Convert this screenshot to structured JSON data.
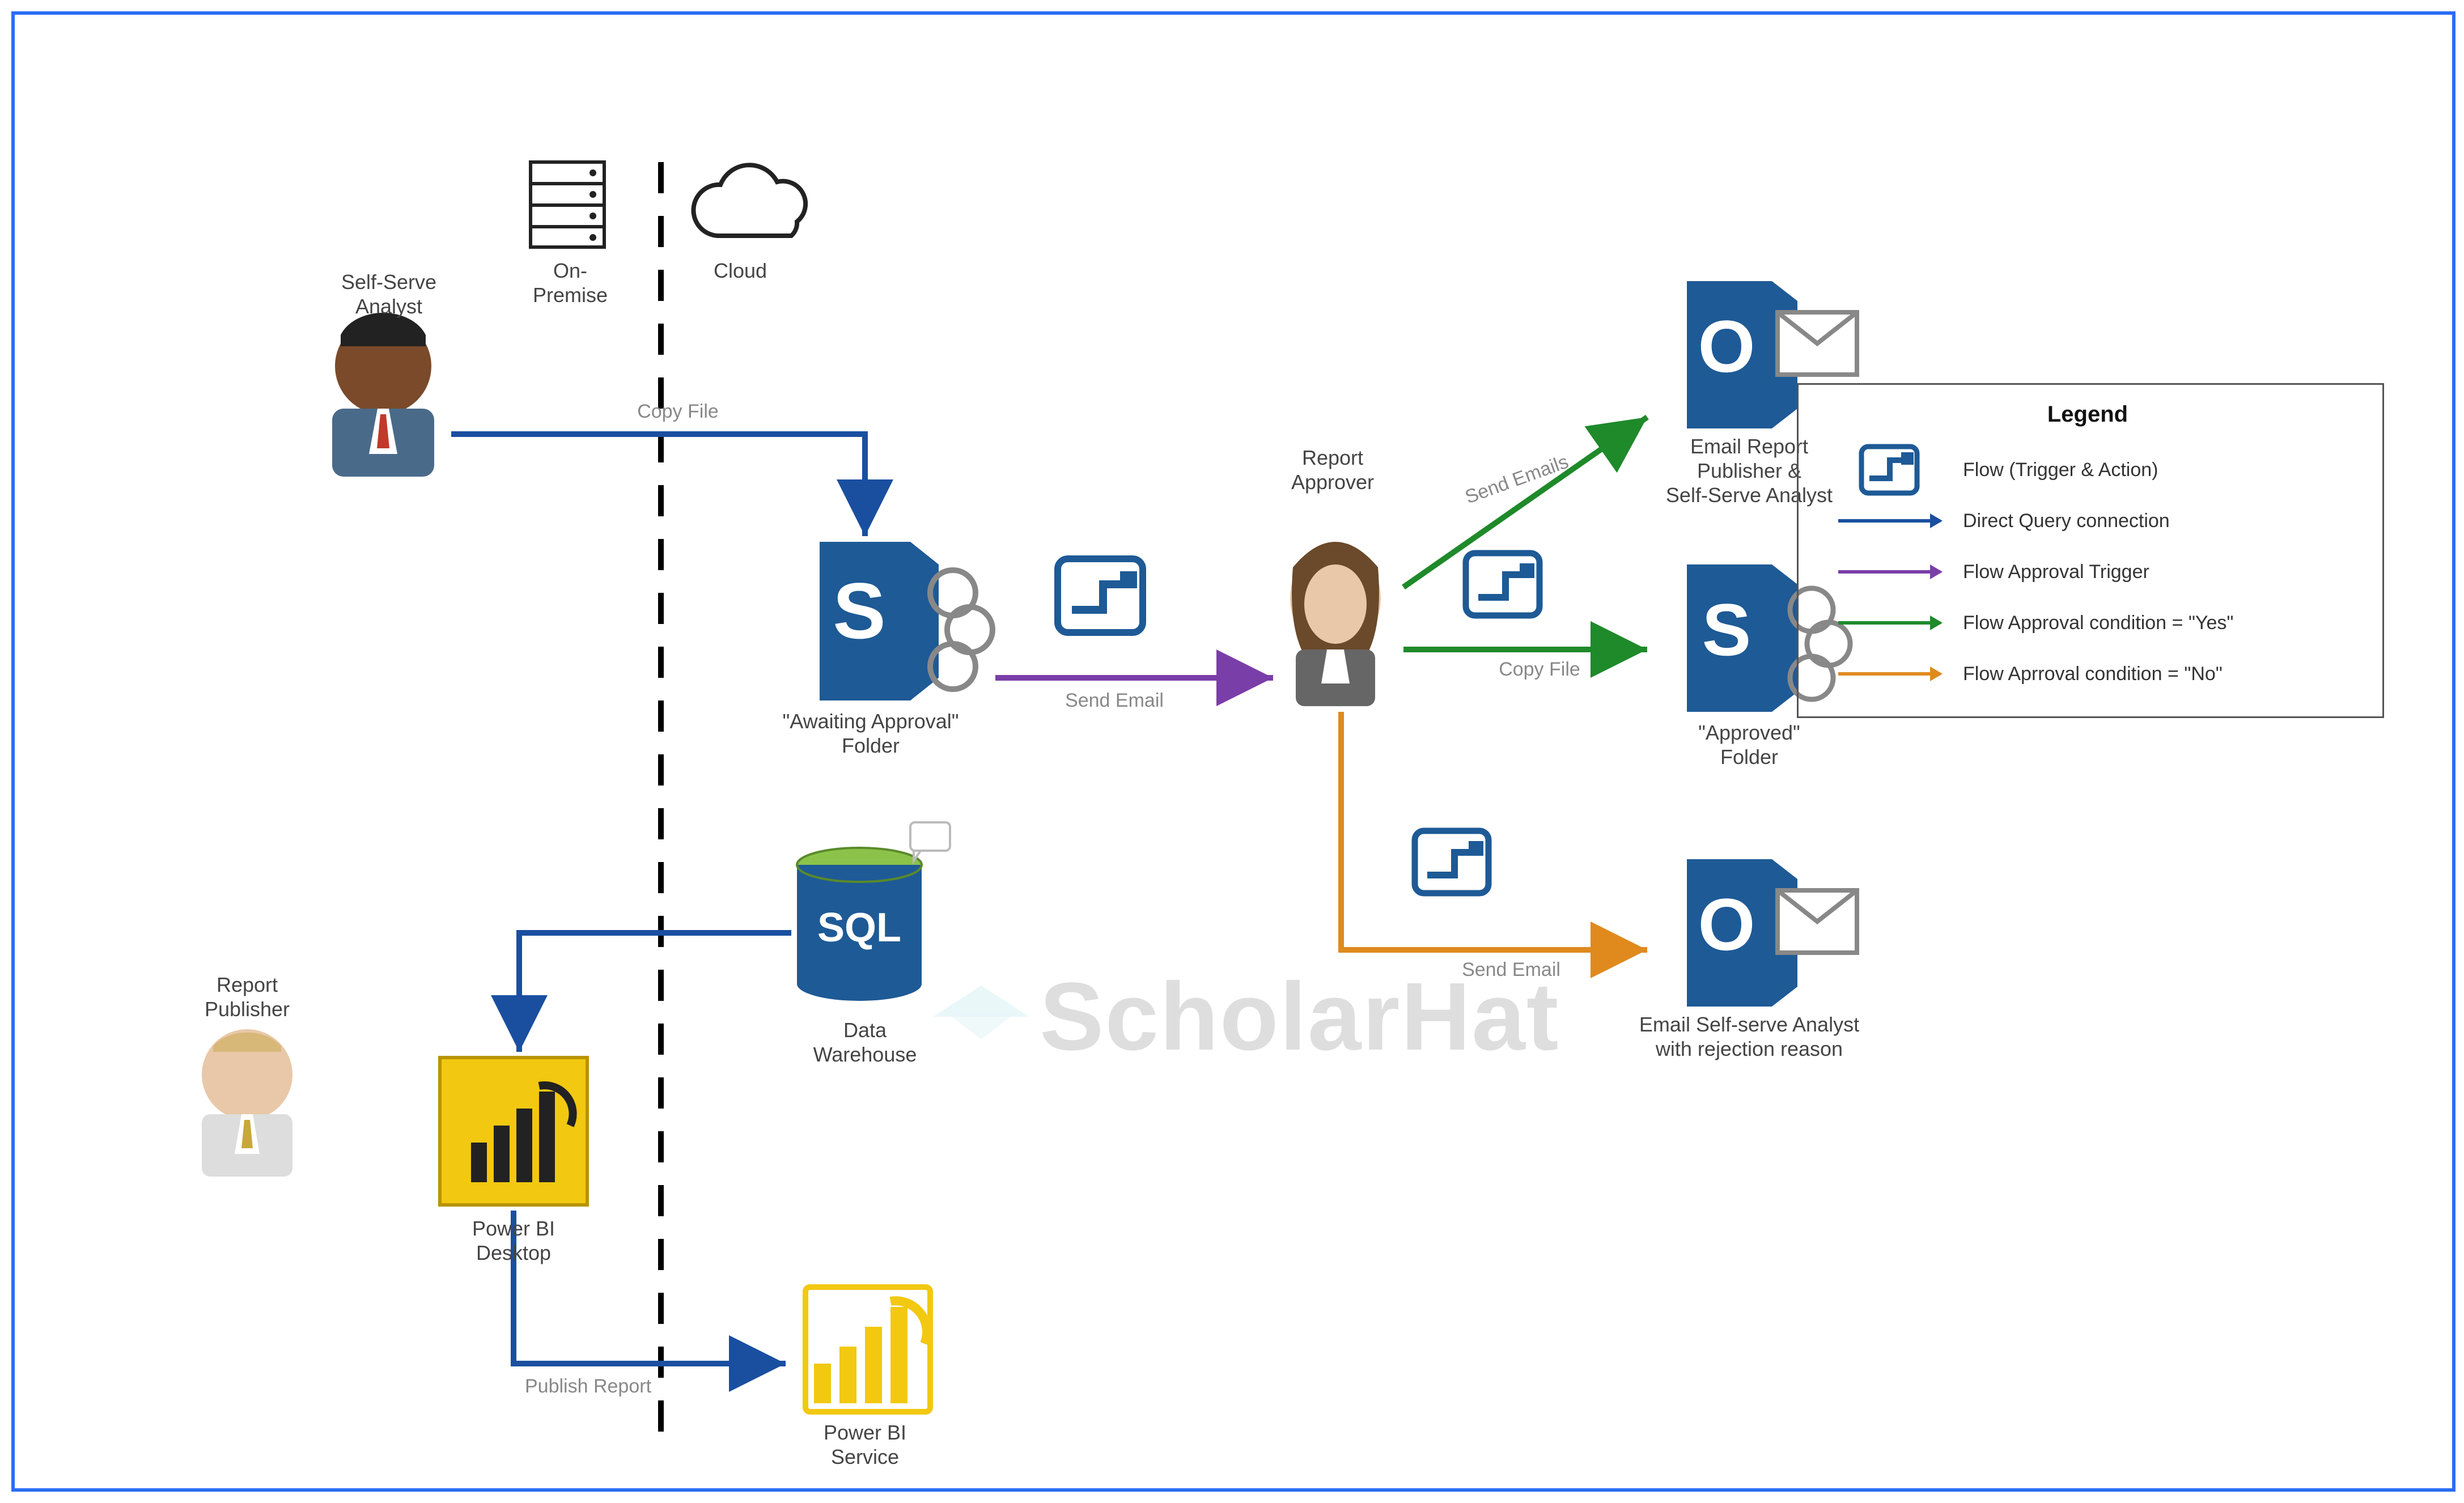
{
  "nodes": {
    "self_serve_analyst": "Self-Serve\nAnalyst",
    "on_premise": "On-Premise",
    "cloud": "Cloud",
    "awaiting_folder": "\"Awaiting Approval\"\nFolder",
    "report_approver": "Report\nApprover",
    "email_publisher_analyst": "Email Report\nPublisher &\nSelf-Serve Analyst",
    "approved_folder": "\"Approved\"\nFolder",
    "email_rejection": "Email Self-serve Analyst\nwith rejection reason",
    "data_warehouse": "Data\nWarehouse",
    "report_publisher": "Report\nPublisher",
    "power_bi_desktop": "Power BI\nDesktop",
    "power_bi_service": "Power BI\nService"
  },
  "edge_labels": {
    "copy_file_1": "Copy File",
    "send_email_1": "Send Email",
    "send_emails": "Send Emails",
    "copy_file_2": "Copy File",
    "send_email_2": "Send Email",
    "publish_report": "Publish Report"
  },
  "legend": {
    "title": "Legend",
    "items": [
      {
        "kind": "icon",
        "text": "Flow (Trigger & Action)"
      },
      {
        "kind": "arrow",
        "color": "#1a4fa0",
        "text": "Direct Query connection"
      },
      {
        "kind": "arrow",
        "color": "#7a3ea8",
        "text": "Flow Approval Trigger"
      },
      {
        "kind": "arrow",
        "color": "#1f8a2a",
        "text": "Flow Approval condition = \"Yes\""
      },
      {
        "kind": "arrow",
        "color": "#e08a1e",
        "text": "Flow Aprroval condition = \"No\""
      }
    ]
  },
  "watermark": "ScholarHat",
  "colors": {
    "direct": "#1a4fa0",
    "approval": "#7a3ea8",
    "yes": "#1f8a2a",
    "no": "#e08a1e",
    "sharepoint": "#1e5a96",
    "outlook": "#1e5a96",
    "pbi_yellow": "#f2c811",
    "sql_green": "#8bc34a",
    "sql_body": "#1e5a96"
  }
}
